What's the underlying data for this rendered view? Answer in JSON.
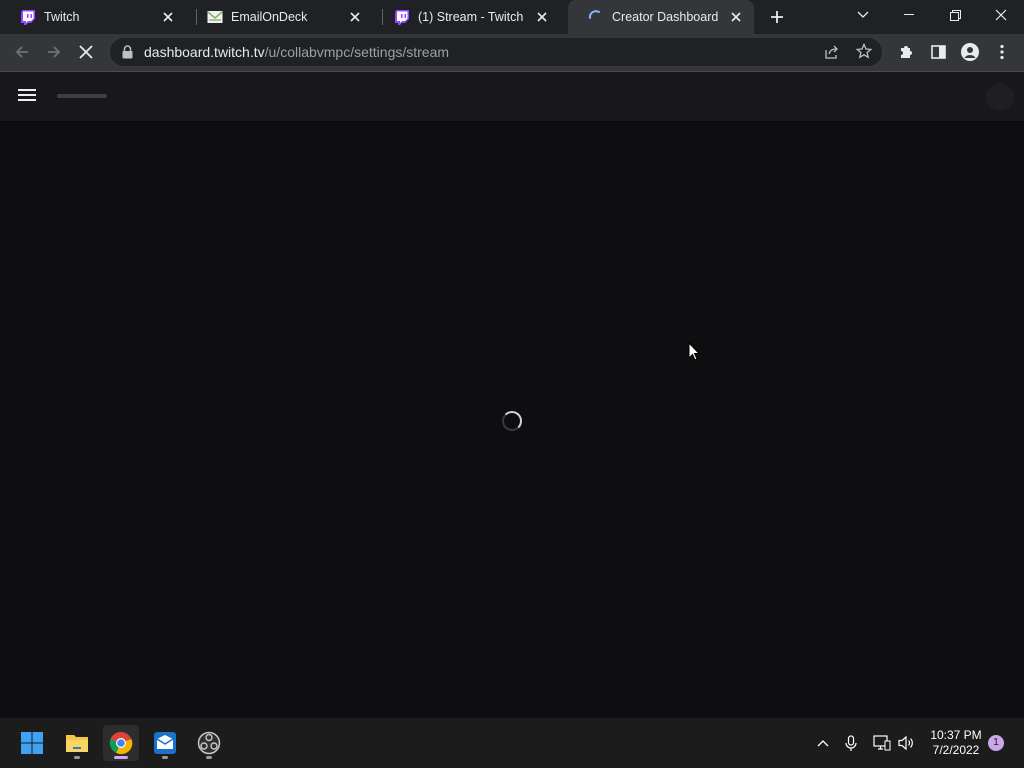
{
  "browser": {
    "tabs": [
      {
        "title": "Twitch",
        "favicon": "twitch-icon",
        "active": false
      },
      {
        "title": "EmailOnDeck",
        "favicon": "emailondeck-icon",
        "active": false
      },
      {
        "title": "(1) Stream - Twitch",
        "favicon": "twitch-icon",
        "active": false
      },
      {
        "title": "Creator Dashboard",
        "favicon": "loading-spinner-icon",
        "active": true
      }
    ],
    "address": {
      "host": "dashboard.twitch.tv",
      "path": "/u/collabvmpc/settings/stream"
    }
  },
  "page": {
    "state": "loading"
  },
  "taskbar": {
    "apps": [
      "start-icon",
      "file-explorer-icon",
      "chrome-icon",
      "mail-app-icon",
      "obs-icon"
    ],
    "clock": {
      "time": "10:37 PM",
      "date": "7/2/2022"
    },
    "notification_count": "1"
  },
  "colors": {
    "twitch_purple": "#9146ff",
    "page_bg": "#0e0e10",
    "header_bg": "#18181b",
    "chrome_toolbar": "#35363a",
    "chrome_tabstrip": "#202124"
  }
}
